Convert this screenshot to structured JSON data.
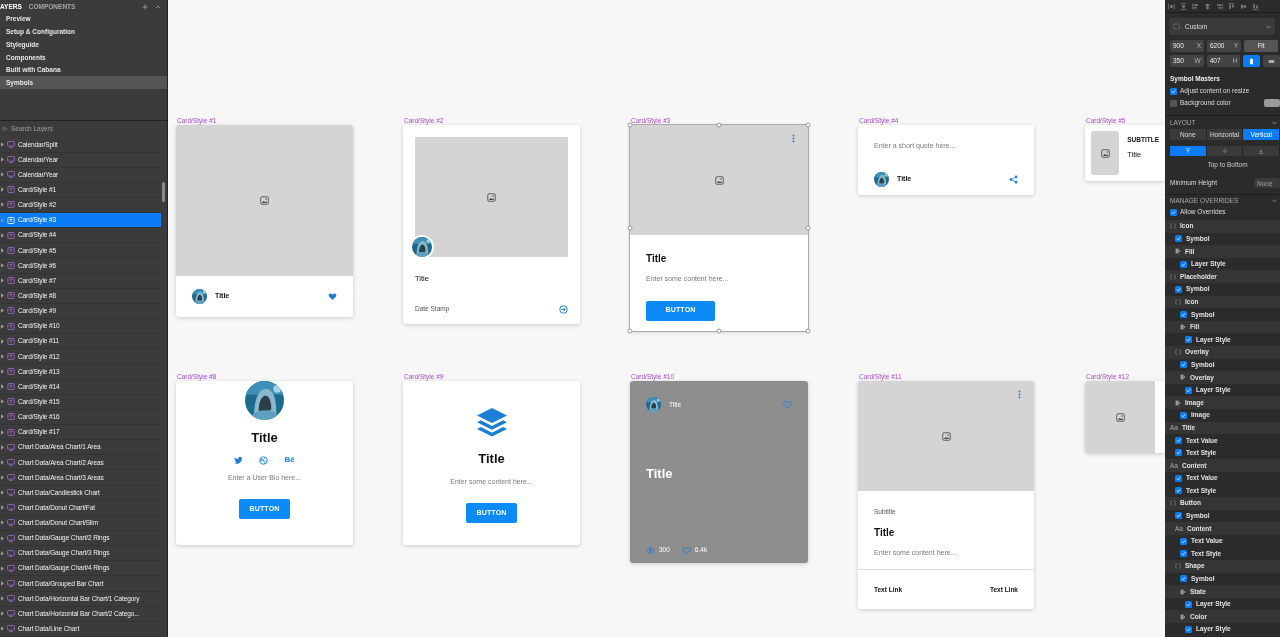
{
  "layers_panel": {
    "tabs": [
      {
        "label": "AYERS",
        "selected": true
      },
      {
        "label": "COMPONENTS",
        "selected": false
      }
    ],
    "pages": [
      {
        "label": "Preview",
        "selected": false
      },
      {
        "label": "Setup & Configuration",
        "selected": false
      },
      {
        "label": "Styleguide",
        "selected": false
      },
      {
        "label": "Components",
        "selected": false
      },
      {
        "label": "Built with Cabana",
        "selected": false
      },
      {
        "label": "Symbols",
        "selected": true
      }
    ],
    "search": {
      "placeholder": "Search Layers"
    },
    "layers": [
      {
        "label": "Calendar/Split",
        "kind": "artboard",
        "selected": false
      },
      {
        "label": "Calendar/Year",
        "kind": "artboard",
        "selected": false
      },
      {
        "label": "Calendar/Year",
        "kind": "artboard",
        "selected": false
      },
      {
        "label": "Card/Style #1",
        "kind": "symbol",
        "selected": false
      },
      {
        "label": "Card/Style #2",
        "kind": "symbol",
        "selected": false
      },
      {
        "label": "Card/Style #3",
        "kind": "symbol",
        "selected": true
      },
      {
        "label": "Card/Style #4",
        "kind": "symbol",
        "selected": false
      },
      {
        "label": "Card/Style #5",
        "kind": "symbol",
        "selected": false
      },
      {
        "label": "Card/Style #6",
        "kind": "symbol",
        "selected": false
      },
      {
        "label": "Card/Style #7",
        "kind": "symbol",
        "selected": false
      },
      {
        "label": "Card/Style #8",
        "kind": "symbol",
        "selected": false
      },
      {
        "label": "Card/Style #9",
        "kind": "symbol",
        "selected": false
      },
      {
        "label": "Card/Style #10",
        "kind": "symbol",
        "selected": false
      },
      {
        "label": "Card/Style #11",
        "kind": "symbol",
        "selected": false
      },
      {
        "label": "Card/Style #12",
        "kind": "symbol",
        "selected": false
      },
      {
        "label": "Card/Style #13",
        "kind": "symbol",
        "selected": false
      },
      {
        "label": "Card/Style #14",
        "kind": "symbol",
        "selected": false
      },
      {
        "label": "Card/Style #15",
        "kind": "symbol",
        "selected": false
      },
      {
        "label": "Card/Style #16",
        "kind": "symbol",
        "selected": false
      },
      {
        "label": "Card/Style #17",
        "kind": "symbol",
        "selected": false
      },
      {
        "label": "Chart Data/Area Chart/1 Area",
        "kind": "artboard",
        "selected": false
      },
      {
        "label": "Chart Data/Area Chart/2 Areas",
        "kind": "artboard",
        "selected": false
      },
      {
        "label": "Chart Data/Area Chart/3 Areas",
        "kind": "artboard",
        "selected": false
      },
      {
        "label": "Chart Data/Candlestick Chart",
        "kind": "artboard",
        "selected": false
      },
      {
        "label": "Chart Data/Donut Chart/Fat",
        "kind": "artboard",
        "selected": false
      },
      {
        "label": "Chart Data/Donut Chart/Slim",
        "kind": "artboard",
        "selected": false
      },
      {
        "label": "Chart Data/Gauge Chart/2 Rings",
        "kind": "artboard",
        "selected": false
      },
      {
        "label": "Chart Data/Gauge Chart/3 Rings",
        "kind": "artboard",
        "selected": false
      },
      {
        "label": "Chart Data/Gauge Chart/4 Rings",
        "kind": "artboard",
        "selected": false
      },
      {
        "label": "Chart Data/Grouped Bar Chart",
        "kind": "artboard",
        "selected": false
      },
      {
        "label": "Chart Data/Horizontal Bar Chart/1 Category",
        "kind": "artboard",
        "selected": false
      },
      {
        "label": "Chart Data/Horizontal Bar Chart/2 Catego...",
        "kind": "artboard",
        "selected": false
      },
      {
        "label": "Chart Data/Line Chart",
        "kind": "artboard",
        "selected": false
      }
    ]
  },
  "canvas": {
    "artboards": [
      {
        "label": "Card/Style #1",
        "kind": "media_footer",
        "selected": false,
        "title": "Title"
      },
      {
        "label": "Card/Style #2",
        "kind": "media_avatar",
        "selected": false,
        "title": "Title",
        "date": "Date Stamp"
      },
      {
        "label": "Card/Style #3",
        "kind": "media_button",
        "selected": true,
        "title": "Title",
        "content": "Enter some content here...",
        "button": "BUTTON"
      },
      {
        "label": "Card/Style #4",
        "kind": "quote",
        "selected": false,
        "quote": "Enter a short quote here...",
        "title": "Title"
      },
      {
        "label": "Card/Style #5",
        "kind": "side_media",
        "selected": false,
        "subtitle": "SUBTITLE",
        "title": "Title"
      },
      {
        "label": "Card/Style #8",
        "kind": "profile",
        "selected": false,
        "title": "Title",
        "social_text": "Bē",
        "bio": "Enter a User Bio here...",
        "button": "BUTTON"
      },
      {
        "label": "Card/Style #9",
        "kind": "feature",
        "selected": false,
        "title": "Title",
        "content": "Enter some content here...",
        "button": "BUTTON"
      },
      {
        "label": "Card/Style #10",
        "kind": "overlay",
        "selected": false,
        "author": "Title",
        "title": "Title",
        "views": "300",
        "likes": "6.4k"
      },
      {
        "label": "Card/Style #11",
        "kind": "article",
        "selected": false,
        "subtitle": "Subtitle",
        "title": "Title",
        "content": "Enter some content here...",
        "links": [
          "Text Link",
          "Text Link"
        ]
      },
      {
        "label": "Card/Style #12",
        "kind": "media_only",
        "selected": false
      }
    ]
  },
  "inspector": {
    "preset": "Custom",
    "fields": [
      {
        "value": "900",
        "unit": "X"
      },
      {
        "value": "6200",
        "unit": "Y"
      },
      {
        "value": "350",
        "unit": "W"
      },
      {
        "value": "407",
        "unit": "H"
      }
    ],
    "fit_button": "Fit",
    "orientation": [
      {
        "kind": "portrait",
        "selected": true
      },
      {
        "kind": "landscape",
        "selected": false
      }
    ],
    "symbol_masters": {
      "title": "Symbol Masters",
      "options": [
        {
          "label": "Adjust content on resize",
          "checked": true
        },
        {
          "label": "Background color",
          "checked": false
        }
      ]
    },
    "layout": {
      "title": "LAYOUT",
      "modes": [
        {
          "label": "None",
          "selected": false
        },
        {
          "label": "Horizontal",
          "selected": false
        },
        {
          "label": "Vertical",
          "selected": true
        }
      ],
      "anchors": [
        {
          "kind": "top",
          "selected": true
        },
        {
          "kind": "middle",
          "selected": false
        },
        {
          "kind": "bottom",
          "selected": false
        }
      ],
      "anchor_caption": "Top to Bottom",
      "min_height": {
        "label": "Minimum Height",
        "placeholder": "None"
      }
    },
    "overrides": {
      "title": "MANAGE OVERRIDES",
      "allow": {
        "label": "Allow Overrides",
        "checked": true
      },
      "items": [
        {
          "label": "Icon",
          "kind": "symbol",
          "children": [
            {
              "label": "Symbol",
              "kind": "check",
              "checked": true
            },
            {
              "label": "Fill",
              "kind": "style",
              "children": [
                {
                  "label": "Layer Style",
                  "kind": "check",
                  "checked": true
                }
              ]
            }
          ]
        },
        {
          "label": "Placeholder",
          "kind": "symbol",
          "children": [
            {
              "label": "Symbol",
              "kind": "check",
              "checked": true
            },
            {
              "label": "Icon",
              "kind": "symbol",
              "children": [
                {
                  "label": "Symbol",
                  "kind": "check",
                  "checked": true
                },
                {
                  "label": "Fill",
                  "kind": "style",
                  "children": [
                    {
                      "label": "Layer Style",
                      "kind": "check",
                      "checked": true
                    }
                  ]
                }
              ]
            },
            {
              "label": "Overlay",
              "kind": "symbol",
              "children": [
                {
                  "label": "Symbol",
                  "kind": "check",
                  "checked": true
                },
                {
                  "label": "Overlay",
                  "kind": "style",
                  "children": [
                    {
                      "label": "Layer Style",
                      "kind": "check",
                      "checked": true
                    }
                  ]
                }
              ]
            },
            {
              "label": "Image",
              "kind": "style",
              "children": [
                {
                  "label": "Image",
                  "kind": "check",
                  "checked": true
                }
              ]
            }
          ]
        },
        {
          "label": "Title",
          "kind": "text",
          "glyph": "Aa",
          "children": [
            {
              "label": "Text Value",
              "kind": "check",
              "checked": true
            },
            {
              "label": "Text Style",
              "kind": "check",
              "checked": true
            }
          ]
        },
        {
          "label": "Content",
          "kind": "text",
          "glyph": "Aa",
          "children": [
            {
              "label": "Text Value",
              "kind": "check",
              "checked": true
            },
            {
              "label": "Text Style",
              "kind": "check",
              "checked": true
            }
          ]
        },
        {
          "label": "Button",
          "kind": "symbol",
          "children": [
            {
              "label": "Symbol",
              "kind": "check",
              "checked": true
            },
            {
              "label": "Content",
              "kind": "text",
              "glyph": "Aa",
              "children": [
                {
                  "label": "Text Value",
                  "kind": "check",
                  "checked": true
                },
                {
                  "label": "Text Style",
                  "kind": "check",
                  "checked": true
                }
              ]
            },
            {
              "label": "Shape",
              "kind": "symbol",
              "children": [
                {
                  "label": "Symbol",
                  "kind": "check",
                  "checked": true
                },
                {
                  "label": "State",
                  "kind": "style",
                  "children": [
                    {
                      "label": "Layer Style",
                      "kind": "check",
                      "checked": true
                    }
                  ]
                },
                {
                  "label": "Color",
                  "kind": "style",
                  "children": [
                    {
                      "label": "Layer Style",
                      "kind": "check",
                      "checked": true
                    }
                  ]
                }
              ]
            }
          ]
        }
      ]
    }
  }
}
